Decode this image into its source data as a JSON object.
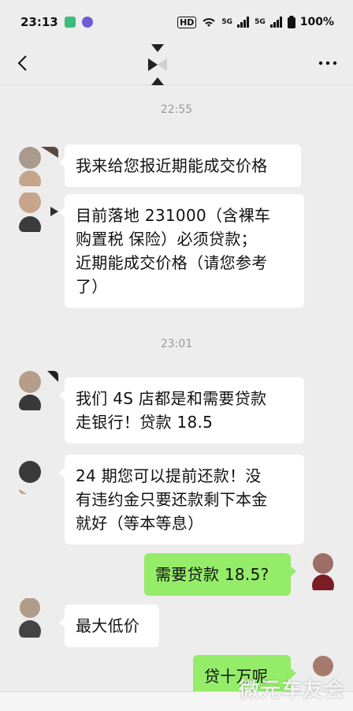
{
  "status_bar": {
    "time": "23:13",
    "hd_badge": "HD",
    "network_1": "5G",
    "network_2": "5G",
    "battery": "100%"
  },
  "chat": {
    "title": "",
    "back_icon": "chevron-left-icon",
    "more_icon": "more-horizontal-icon"
  },
  "timestamps": [
    "22:55",
    "23:01"
  ],
  "messages": [
    {
      "side": "left",
      "text": "我来给您报近期能成交价格"
    },
    {
      "side": "left",
      "lines": [
        "目前落地 231000（含裸车",
        "购置税  保险）必须贷款；",
        "近期能成交价格（请您参考",
        "了）"
      ]
    },
    {
      "side": "left",
      "lines": [
        "我们 4S 店都是和需要贷款",
        "走银行！贷款 18.5"
      ]
    },
    {
      "side": "left",
      "lines": [
        "24 期您可以提前还款！没",
        "有违约金只要还款剩下本金",
        "就好（等本等息）"
      ]
    },
    {
      "side": "right",
      "text": "需要贷款 18.5?"
    },
    {
      "side": "left",
      "text": "最大低价"
    },
    {
      "side": "right",
      "text": "贷十万呢"
    }
  ],
  "watermark": "微元车友会",
  "colors": {
    "bubble_self": "#95ec69",
    "bubble_other": "#ffffff",
    "background": "#ededed"
  }
}
